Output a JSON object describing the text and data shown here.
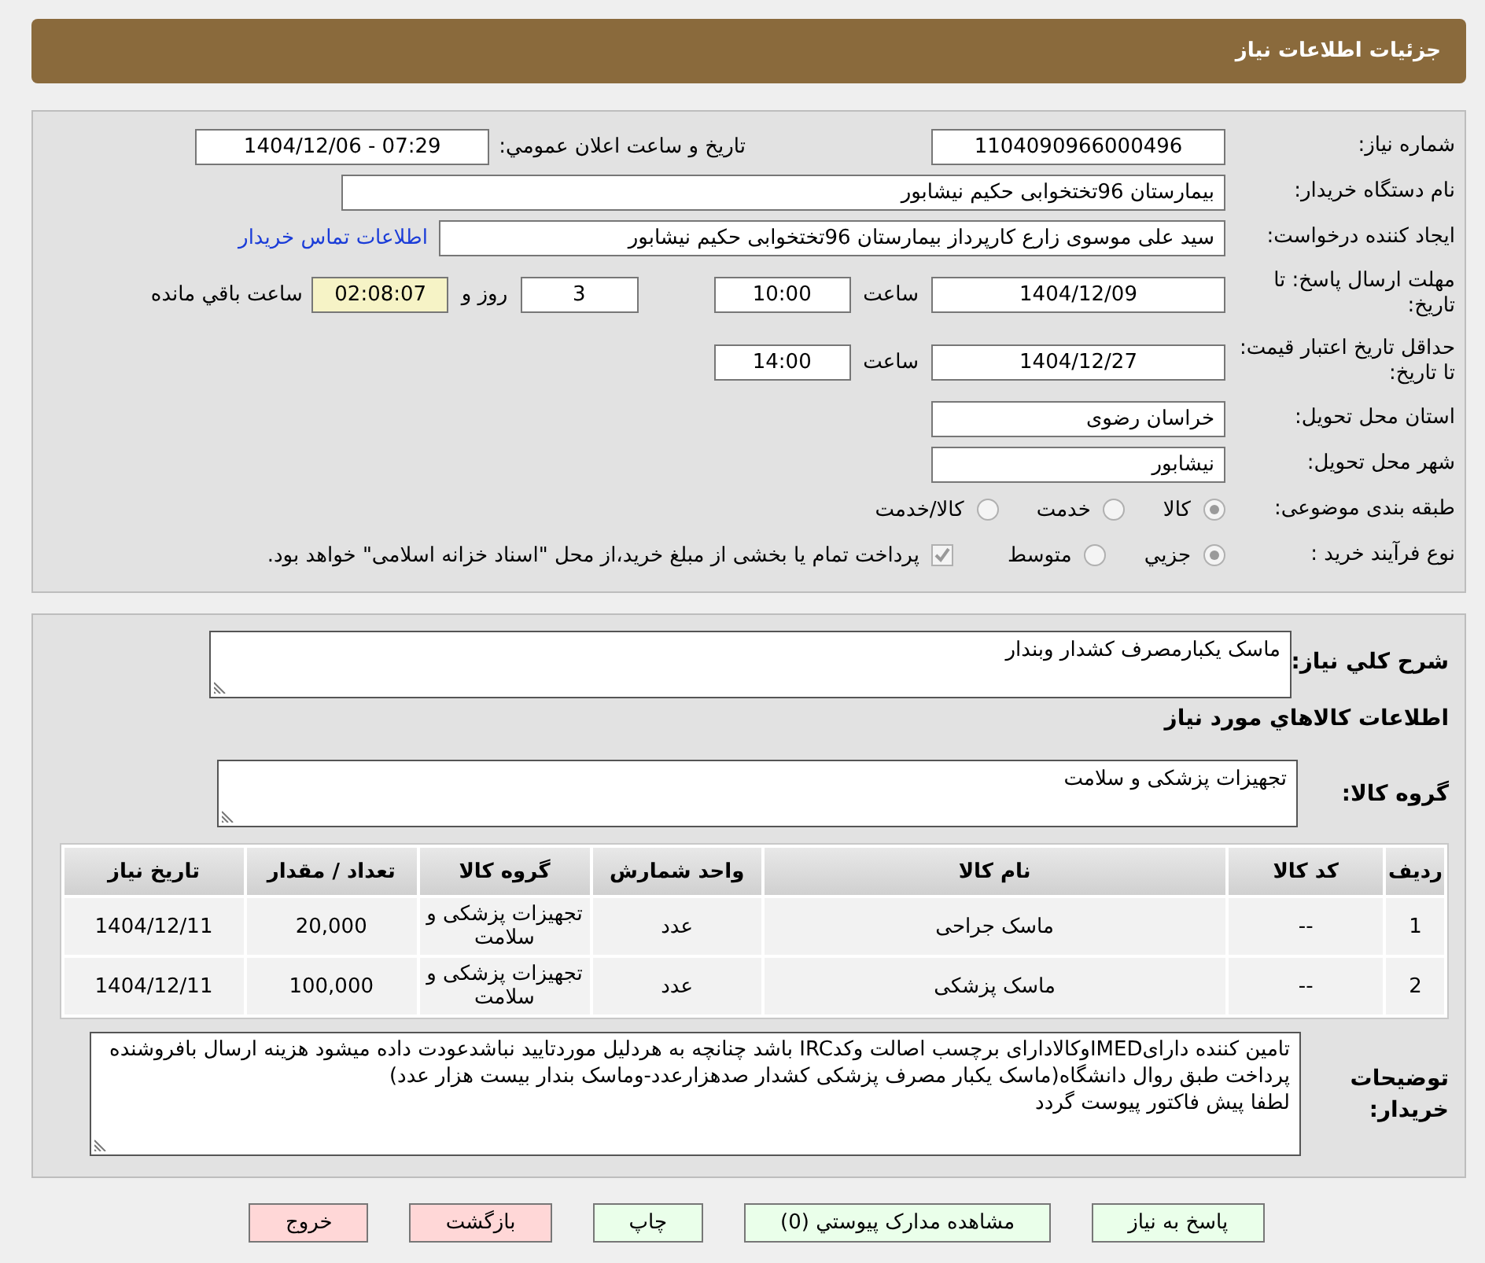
{
  "header": {
    "title": "جزئیات اطلاعات نیاز"
  },
  "need_number": {
    "label": "شماره نیاز:",
    "value": "1104090966000496"
  },
  "announce": {
    "label": "تاريخ و ساعت اعلان عمومي:",
    "value": "1404/12/06 - 07:29"
  },
  "buyer_org": {
    "label": "نام دستگاه خریدار:",
    "value": "بیمارستان 96تختخوابی حکیم نیشابور"
  },
  "requester": {
    "label": "ایجاد کننده درخواست:",
    "value": "سید علی  موسوی زارع کارپرداز بیمارستان 96تختخوابی حکیم نیشابور",
    "link": "اطلاعات تماس خریدار"
  },
  "deadline": {
    "label": "مهلت ارسال پاسخ: تا تاریخ:",
    "date": "1404/12/09",
    "time_label": "ساعت",
    "time": "10:00",
    "days": "3",
    "days_label": "روز و",
    "remaining": "02:08:07",
    "remaining_label": "ساعت باقي مانده"
  },
  "validity": {
    "label": "حداقل تاریخ اعتبار قیمت: تا تاریخ:",
    "date": "1404/12/27",
    "time_label": "ساعت",
    "time": "14:00"
  },
  "province": {
    "label": "استان محل تحویل:",
    "value": "خراسان رضوی"
  },
  "city": {
    "label": "شهر محل تحویل:",
    "value": "نیشابور"
  },
  "category": {
    "label": "طبقه بندی موضوعی:",
    "options": [
      {
        "label": "کالا",
        "selected": true
      },
      {
        "label": "خدمت",
        "selected": false
      },
      {
        "label": "کالا/خدمت",
        "selected": false
      }
    ]
  },
  "process": {
    "label": "نوع فرآیند خرید :",
    "options": [
      {
        "label": "جزيي",
        "selected": true
      },
      {
        "label": "متوسط",
        "selected": false
      }
    ],
    "payment": {
      "label": "پرداخت تمام یا بخشی از مبلغ خرید،از محل \"اسناد خزانه اسلامی\" خواهد بود.",
      "checked": true
    }
  },
  "description": {
    "label": "شرح كلي نياز:",
    "value": "ماسک یکبارمصرف کشدار وبندار"
  },
  "items_heading": "اطلاعات كالاهاي مورد نياز",
  "goods_group": {
    "label": "گروه کالا:",
    "value": "تجهیزات پزشکی و سلامت"
  },
  "table": {
    "columns": [
      "ردیف",
      "کد کالا",
      "نام کالا",
      "واحد شمارش",
      "گروه کالا",
      "تعداد / مقدار",
      "تاریخ نیاز"
    ],
    "rows": [
      [
        "1",
        "--",
        "ماسک جراحی",
        "عدد",
        "تجهیزات پزشکی و سلامت",
        "20,000",
        "1404/12/11"
      ],
      [
        "2",
        "--",
        "ماسک پزشکی",
        "عدد",
        "تجهیزات پزشکی و سلامت",
        "100,000",
        "1404/12/11"
      ]
    ]
  },
  "notes": {
    "label": "توضیحات خریدار:",
    "paragraphs": [
      "تامین کننده دارایIMEDوکالادارای برچسب اصالت وکدIRC باشد چنانچه به هردلیل موردتایید نباشدعودت داده میشود هزینه ارسال بافروشنده پرداخت طبق روال دانشگاه(ماسک یکبار مصرف پزشکی کشدار صدهزارعدد-وماسک بندار بیست هزار عدد)",
      "لطفا پیش فاکتور پیوست گردد"
    ]
  },
  "buttons": [
    {
      "label": "پاسخ به نیاز",
      "kind": "normal"
    },
    {
      "label": "مشاهده مدارک پیوستي (0)",
      "kind": "normal"
    },
    {
      "label": "چاپ",
      "kind": "normal"
    },
    {
      "label": "بازگشت",
      "kind": "danger"
    },
    {
      "label": "خروج",
      "kind": "danger"
    }
  ]
}
